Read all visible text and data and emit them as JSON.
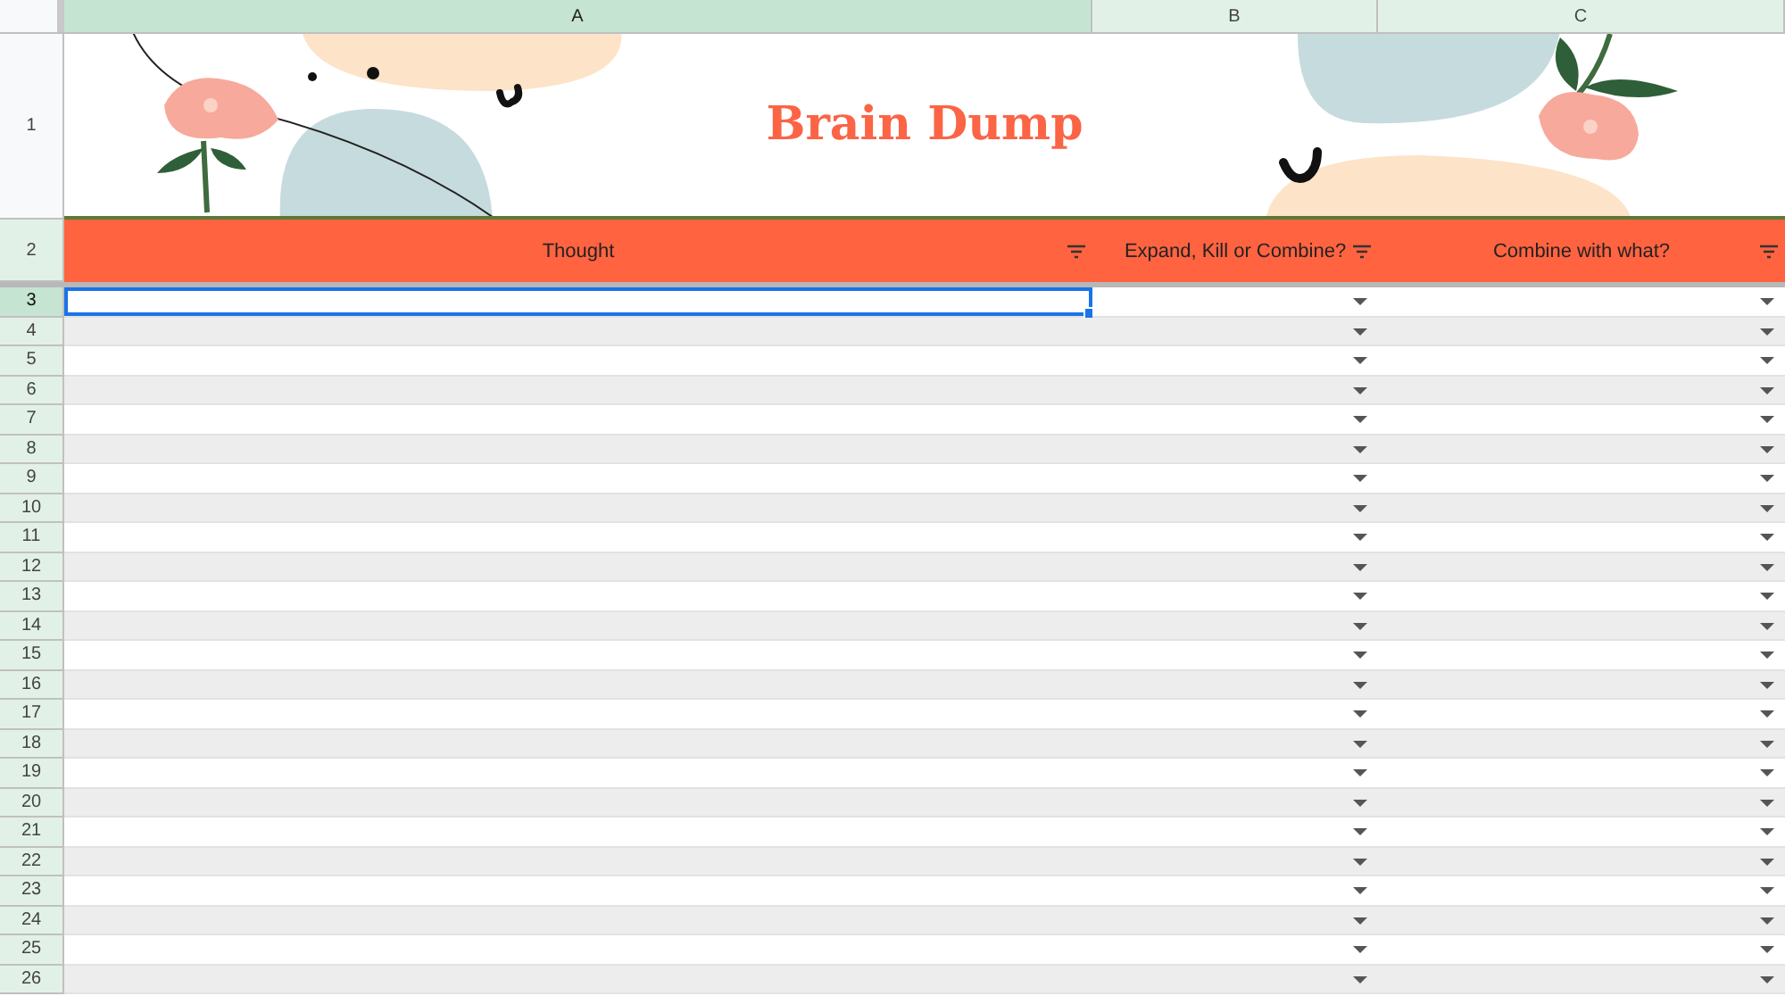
{
  "columns": [
    {
      "label": "A",
      "selected": true
    },
    {
      "label": "B",
      "selected": false
    },
    {
      "label": "C",
      "selected": false
    }
  ],
  "banner": {
    "row": "1",
    "title": "Brain Dump",
    "highlighted": false
  },
  "header_row": {
    "row": "2",
    "highlighted": true,
    "cells": [
      {
        "text": "Thought",
        "filter": true,
        "dropdown": false
      },
      {
        "text": "Expand, Kill or Combine?",
        "filter": true,
        "dropdown": true
      },
      {
        "text": "Combine with what?",
        "filter": true,
        "dropdown": true
      }
    ]
  },
  "rows": [
    {
      "number": "3",
      "selected": true
    },
    {
      "number": "4",
      "selected": false
    },
    {
      "number": "5",
      "selected": false
    },
    {
      "number": "6",
      "selected": false
    },
    {
      "number": "7",
      "selected": false
    },
    {
      "number": "8",
      "selected": false
    },
    {
      "number": "9",
      "selected": false
    },
    {
      "number": "10",
      "selected": false
    },
    {
      "number": "11",
      "selected": false
    },
    {
      "number": "12",
      "selected": false
    },
    {
      "number": "13",
      "selected": false
    },
    {
      "number": "14",
      "selected": false
    },
    {
      "number": "15",
      "selected": false
    },
    {
      "number": "16",
      "selected": false
    },
    {
      "number": "17",
      "selected": false
    },
    {
      "number": "18",
      "selected": false
    },
    {
      "number": "19",
      "selected": false
    },
    {
      "number": "20",
      "selected": false
    },
    {
      "number": "21",
      "selected": false
    },
    {
      "number": "22",
      "selected": false
    },
    {
      "number": "23",
      "selected": false
    },
    {
      "number": "24",
      "selected": false
    },
    {
      "number": "25",
      "selected": false
    },
    {
      "number": "26",
      "selected": false
    }
  ]
}
